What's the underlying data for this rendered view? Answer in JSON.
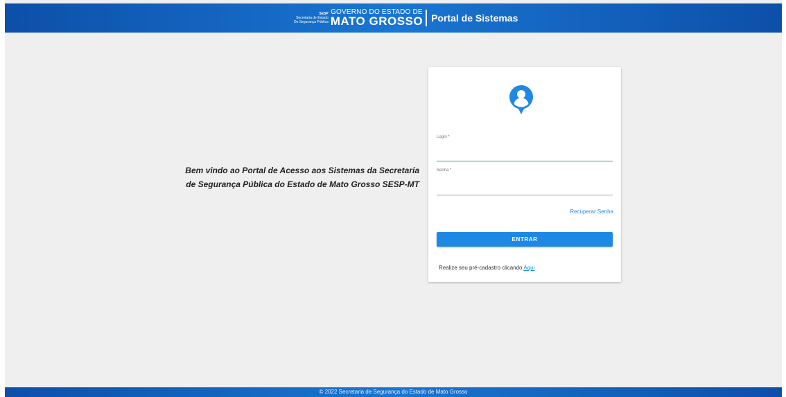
{
  "header": {
    "brand": {
      "sesp": "SESP",
      "secretaria_line1": "Secretaria de Estado",
      "secretaria_line2": "De Segurança Pública",
      "gov": "GOVERNO DO ESTADO DE",
      "state": "MATO GROSSO"
    },
    "portal_title": "Portal de Sistemas"
  },
  "welcome_text": "Bem vindo ao Portal de Acesso aos Sistemas da Secretaria de Segurança Pública do Estado de Mato Grosso SESP-MT",
  "login_form": {
    "avatar_icon": "user-pin-icon",
    "login_label": "Login *",
    "login_value": "",
    "password_label": "Senha *",
    "password_value": "",
    "recover_link": "Recuperar Senha",
    "submit_label": "ENTRAR",
    "prereg_text": "Realize seu pré-cadastro clicando",
    "prereg_link": "Aqui"
  },
  "footer": {
    "text": "© 2022 Secretaria de Segurança do Estado de Mato Grosso"
  },
  "colors": {
    "header_blue": "#0d4fa8",
    "accent_blue": "#1e88e5",
    "active_underline": "#22a58a",
    "background": "#efefef"
  }
}
